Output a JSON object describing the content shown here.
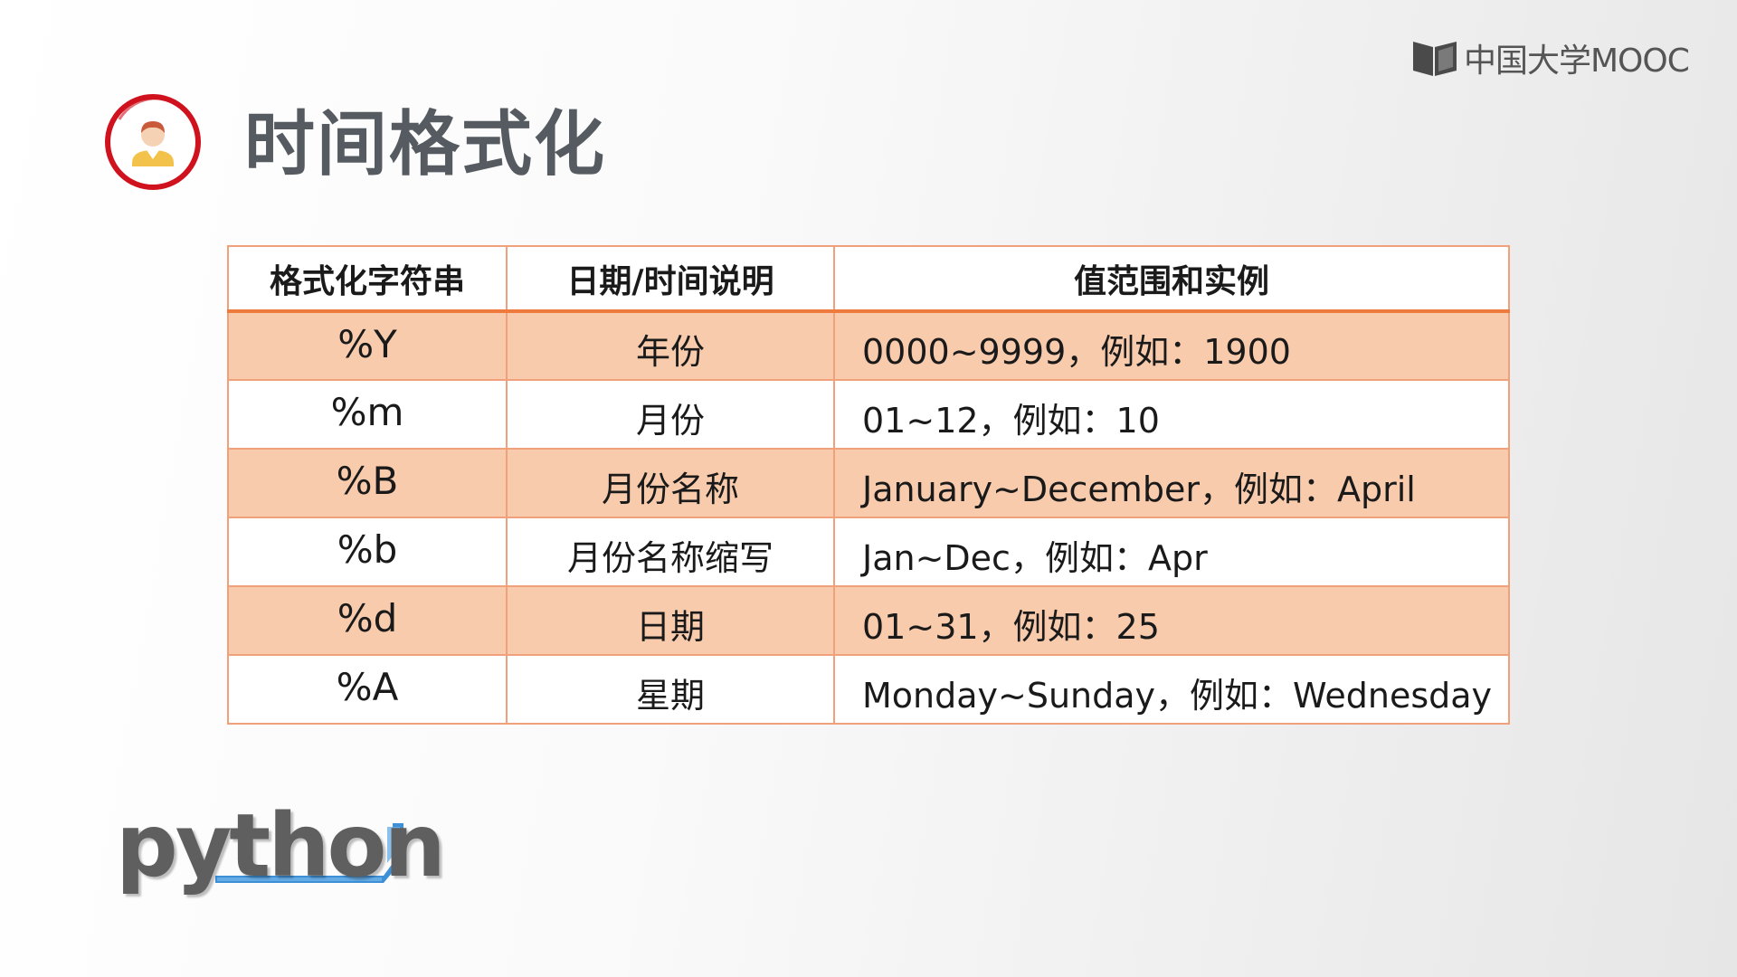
{
  "logo": {
    "text": "中国大学MOOC"
  },
  "header": {
    "title": "时间格式化"
  },
  "table": {
    "columns": [
      "格式化字符串",
      "日期/时间说明",
      "值范围和实例"
    ],
    "rows": [
      {
        "code": "%Y",
        "description": "年份",
        "range": "0000~9999，例如：1900"
      },
      {
        "code": "%m",
        "description": "月份",
        "range": "01~12，例如：10"
      },
      {
        "code": "%B",
        "description": "月份名称",
        "range": "January~December，例如：April"
      },
      {
        "code": "%b",
        "description": "月份名称缩写",
        "range": "Jan~Dec，例如：Apr"
      },
      {
        "code": "%d",
        "description": "日期",
        "range": "01~31，例如：25"
      },
      {
        "code": "%A",
        "description": "星期",
        "range": "Monday~Sunday，例如：Wednesday"
      }
    ]
  },
  "footer_logo": {
    "text": "python"
  },
  "colors": {
    "row_tint": "#f8cbad",
    "border": "#f0a07a",
    "header_rule": "#ef7a3e",
    "avatar_ring": "#d0121f",
    "title": "#555b60",
    "python_underline": "#3d8fd6"
  },
  "icons": [
    "mooc-book-icon",
    "teacher-avatar-icon"
  ]
}
